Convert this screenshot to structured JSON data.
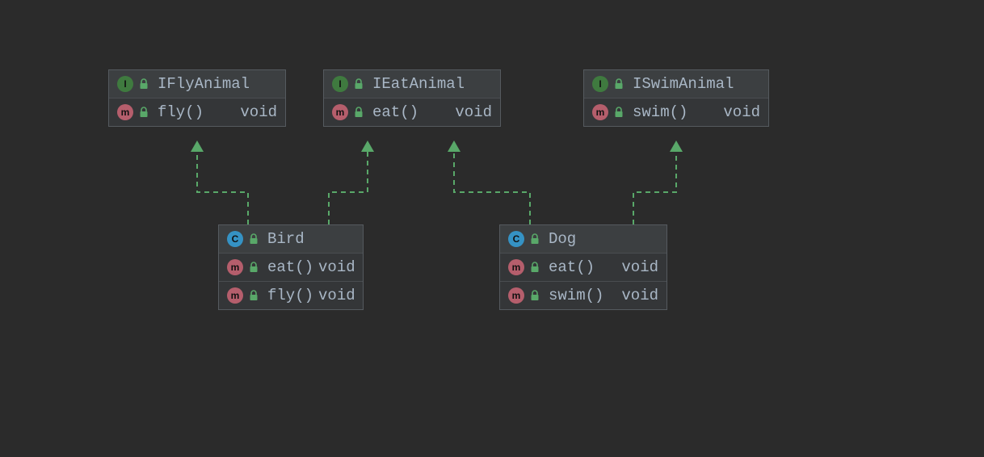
{
  "diagram": {
    "interfaces": [
      {
        "id": "iflyanimal",
        "kind": "interface",
        "name": "IFlyAnimal",
        "members": [
          {
            "kind": "method",
            "sig": "fly()",
            "returns": "void"
          }
        ]
      },
      {
        "id": "ieatanimal",
        "kind": "interface",
        "name": "IEatAnimal",
        "members": [
          {
            "kind": "method",
            "sig": "eat()",
            "returns": "void"
          }
        ]
      },
      {
        "id": "iswimanimal",
        "kind": "interface",
        "name": "ISwimAnimal",
        "members": [
          {
            "kind": "method",
            "sig": "swim()",
            "returns": "void"
          }
        ]
      }
    ],
    "classes": [
      {
        "id": "bird",
        "kind": "class",
        "name": "Bird",
        "implements": [
          "IFlyAnimal",
          "IEatAnimal"
        ],
        "members": [
          {
            "kind": "method",
            "sig": "eat()",
            "returns": "void"
          },
          {
            "kind": "method",
            "sig": "fly()",
            "returns": "void"
          }
        ]
      },
      {
        "id": "dog",
        "kind": "class",
        "name": "Dog",
        "implements": [
          "IEatAnimal",
          "ISwimAnimal"
        ],
        "members": [
          {
            "kind": "method",
            "sig": "eat()",
            "returns": "void"
          },
          {
            "kind": "method",
            "sig": "swim()",
            "returns": "void"
          }
        ]
      }
    ],
    "relations": [
      {
        "from": "bird",
        "to": "iflyanimal",
        "type": "implements"
      },
      {
        "from": "bird",
        "to": "ieatanimal",
        "type": "implements"
      },
      {
        "from": "dog",
        "to": "ieatanimal",
        "type": "implements"
      },
      {
        "from": "dog",
        "to": "iswimanimal",
        "type": "implements"
      }
    ],
    "colors": {
      "background": "#2b2b2b",
      "box_border": "#555a5f",
      "box_bg": "#343638",
      "header_bg": "#3c3f41",
      "text": "#a9b7c6",
      "arrow": "#59a869",
      "badge_interface": "#3f7a3f",
      "badge_class": "#3592c4",
      "badge_method": "#b55e6c",
      "lock": "#59a869"
    },
    "badges": {
      "interface": "I",
      "class": "C",
      "method": "m"
    }
  }
}
